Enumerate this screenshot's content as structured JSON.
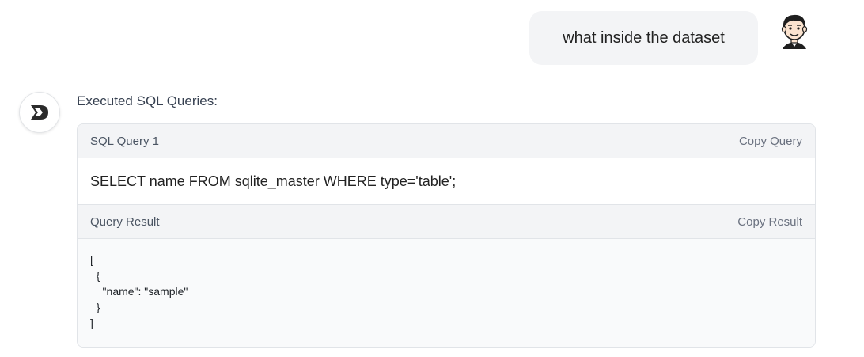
{
  "user_message": {
    "text": "what inside the dataset",
    "avatar_icon": "user-avatar-icon"
  },
  "assistant": {
    "avatar_icon": "assistant-logo-icon",
    "executed_label": "Executed SQL Queries:",
    "query_card": {
      "query_title": "SQL Query 1",
      "copy_query_label": "Copy Query",
      "sql": "SELECT name FROM sqlite_master WHERE type='table';",
      "result_title": "Query Result",
      "copy_result_label": "Copy Result",
      "result_text": "[\n  {\n    \"name\": \"sample\"\n  }\n]"
    }
  },
  "colors": {
    "bubble_bg": "#f3f4f6",
    "card_header_bg": "#f3f4f6",
    "result_bg": "#f9fafb",
    "border": "#e1e4e8"
  }
}
